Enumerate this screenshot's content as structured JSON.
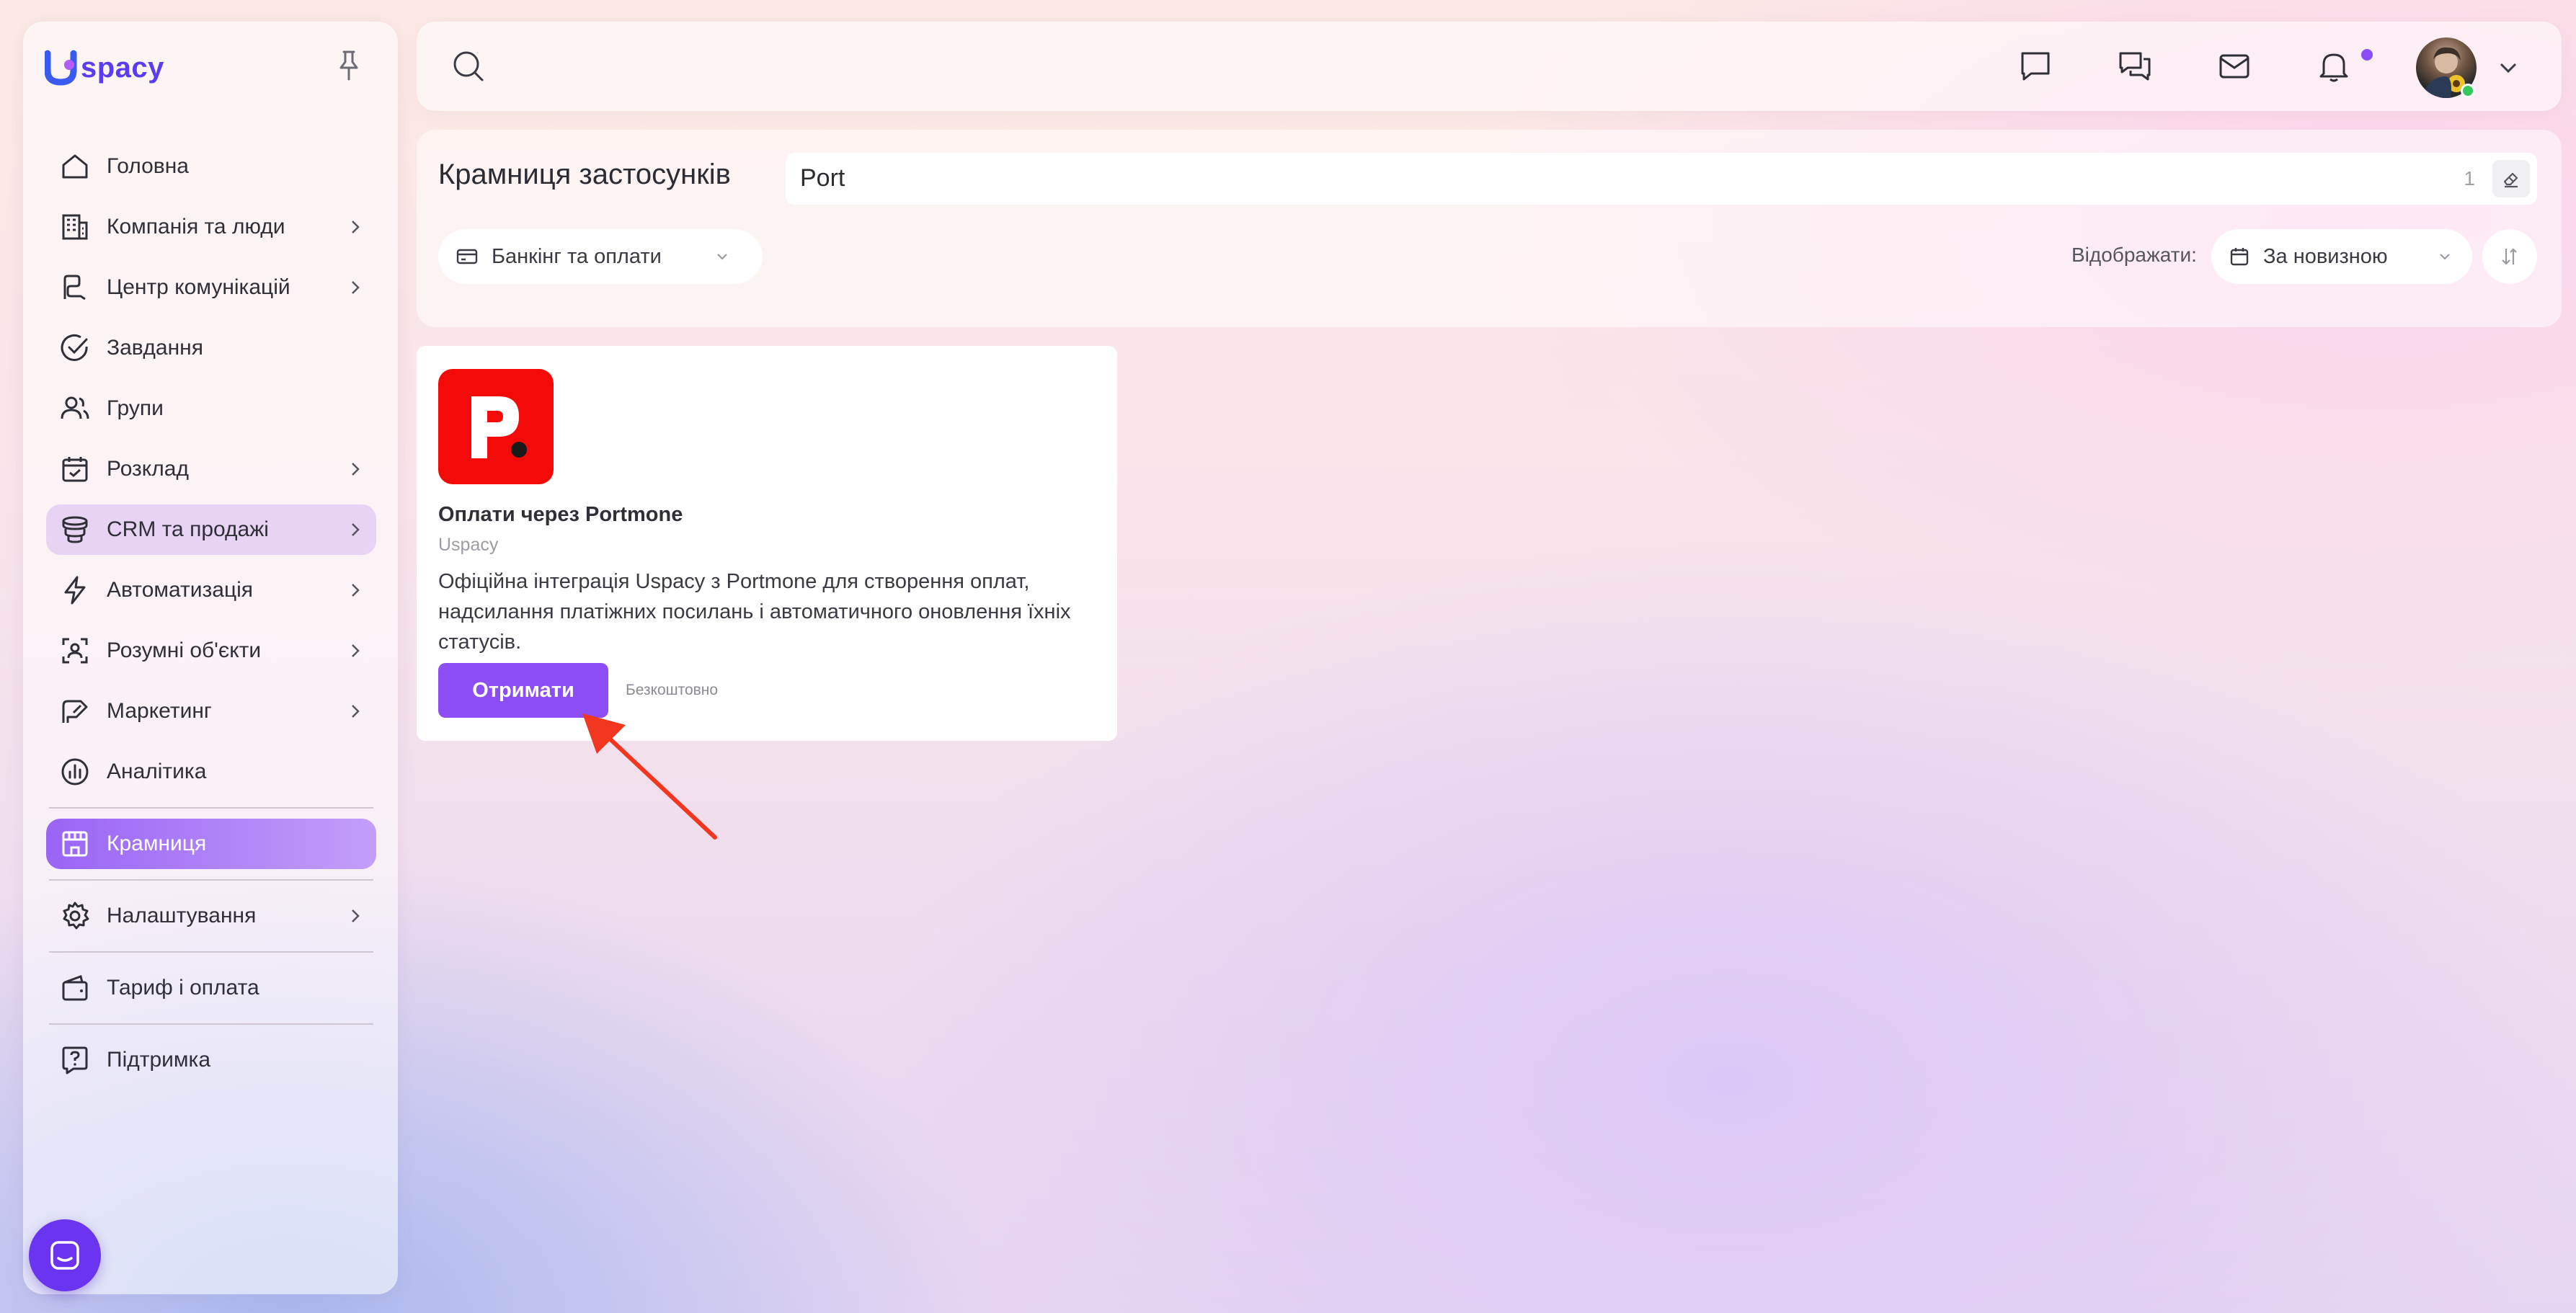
{
  "app": {
    "logo_text": "spacy"
  },
  "sidebar": {
    "items": [
      {
        "label": "Головна",
        "icon": "home-icon"
      },
      {
        "label": "Компанія та люди",
        "icon": "building-icon"
      },
      {
        "label": "Центр комунікацій",
        "icon": "communication-icon"
      },
      {
        "label": "Завдання",
        "icon": "check-circle-icon"
      },
      {
        "label": "Групи",
        "icon": "users-icon"
      },
      {
        "label": "Розклад",
        "icon": "calendar-icon"
      },
      {
        "label": "CRM та продажі",
        "icon": "funnel-icon"
      },
      {
        "label": "Автоматизація",
        "icon": "lightning-icon"
      },
      {
        "label": "Розумні об'єкти",
        "icon": "smart-object-icon"
      },
      {
        "label": "Маркетинг",
        "icon": "marketing-icon"
      },
      {
        "label": "Аналітика",
        "icon": "analytics-icon"
      },
      {
        "label": "Крамниця",
        "icon": "store-icon"
      },
      {
        "label": "Налаштування",
        "icon": "gear-icon"
      },
      {
        "label": "Тариф і оплата",
        "icon": "wallet-icon"
      },
      {
        "label": "Підтримка",
        "icon": "help-icon"
      }
    ]
  },
  "store": {
    "title": "Крамниця застосунків",
    "search_value": "Port",
    "result_count": "1",
    "category_filter": "Банкінг та оплати",
    "sort_label": "Відображати:",
    "sort_value": "За новизною"
  },
  "card": {
    "logo_letter": "p",
    "name": "Оплати через Portmone",
    "vendor": "Uspacy",
    "description": "Офіційна інтеграція Uspacy з Portmone для створення оплат, надсилання платіжних посилань і автоматичного оновлення їхніх статусів.",
    "button_label": "Отримати",
    "price": "Безкоштовно"
  },
  "colors": {
    "accent": "#8c4ef4",
    "crm_highlight": "#e7d3f3",
    "portmone_red": "#f50a0a",
    "annotation_arrow": "#f2361f"
  }
}
